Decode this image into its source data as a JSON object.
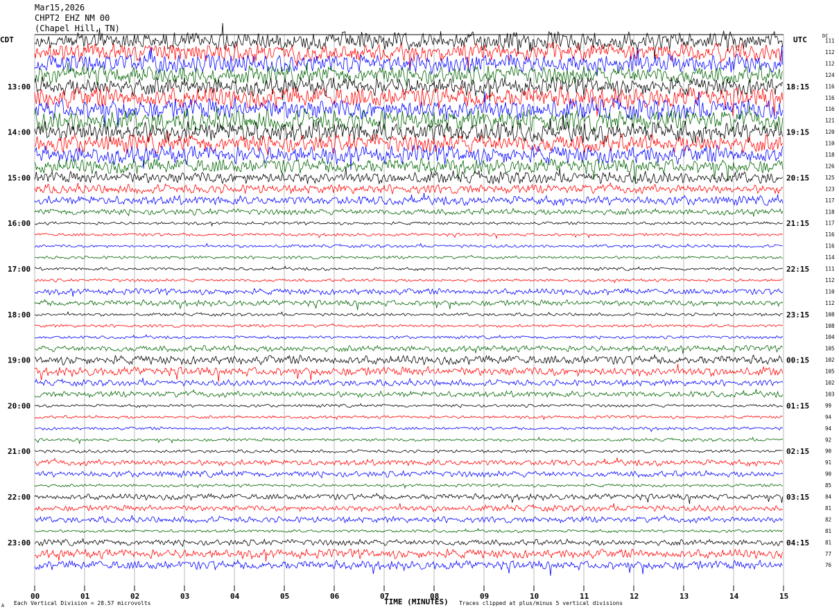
{
  "header": {
    "date": "Mar15,2026",
    "station": "CHPT2 EHZ NM 00",
    "location": "(Chapel Hill, TN)"
  },
  "labels": {
    "left_tz": "CDT",
    "right_tz": "UTC",
    "dc": "DC",
    "xlabel": "TIME (MINUTES)",
    "scale_note": "Each Vertical Division =   28.57 microvolts",
    "clip_note": "Traces clipped at plus/minus 5 vertical divisions",
    "corner_mark": "A"
  },
  "colors": {
    "trace_cycle": [
      "#000000",
      "#ff0000",
      "#0000ff",
      "#006400"
    ]
  },
  "chart_data": {
    "type": "line",
    "title": "Mar15,2026 CHPT2 EHZ NM 00 (Chapel Hill, TN)",
    "xlabel": "TIME (MINUTES)",
    "xlim": [
      0,
      15
    ],
    "x_ticks": [
      "00",
      "01",
      "02",
      "03",
      "04",
      "05",
      "06",
      "07",
      "08",
      "09",
      "10",
      "11",
      "12",
      "13",
      "14",
      "15"
    ],
    "left_hour_labels": [
      "13:00",
      "14:00",
      "15:00",
      "16:00",
      "17:00",
      "18:00",
      "19:00",
      "20:00",
      "21:00",
      "22:00",
      "23:00"
    ],
    "right_hour_labels": [
      "18:15",
      "19:15",
      "20:15",
      "21:15",
      "22:15",
      "23:15",
      "00:15",
      "01:15",
      "02:15",
      "03:15",
      "04:15"
    ],
    "dc_offsets": [
      111,
      112,
      112,
      124,
      116,
      116,
      116,
      121,
      120,
      110,
      118,
      126,
      125,
      123,
      117,
      118,
      117,
      116,
      116,
      114,
      111,
      112,
      110,
      112,
      108,
      108,
      104,
      105,
      102,
      105,
      102,
      103,
      99,
      94,
      94,
      92,
      90,
      91,
      90,
      85,
      84,
      81,
      82,
      81,
      81,
      77,
      76
    ],
    "trace_amplitude_level": [
      6,
      6,
      6,
      6,
      6,
      7,
      7,
      7,
      7,
      6,
      6,
      5,
      4,
      3,
      3,
      2,
      1,
      1,
      1,
      1,
      1,
      1,
      2,
      2,
      1,
      1,
      1,
      2,
      3,
      3,
      2,
      2,
      1,
      1,
      1,
      1,
      1,
      2,
      2,
      1,
      2,
      2,
      2,
      1,
      2,
      3,
      3
    ],
    "trace_count": 47,
    "clip_divisions": 5,
    "microvolts_per_division": 28.57
  }
}
